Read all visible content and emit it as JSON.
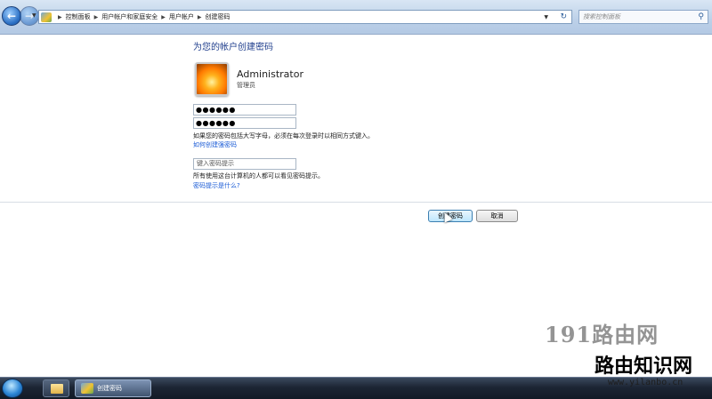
{
  "address_bar": {
    "breadcrumbs": [
      "控制面板",
      "用户帐户和家庭安全",
      "用户帐户",
      "创建密码"
    ],
    "search_placeholder": "搜索控制面板"
  },
  "main": {
    "title": "为您的帐户创建密码",
    "user": {
      "name": "Administrator",
      "role": "管理员"
    },
    "new_password": "●●●●●●",
    "confirm_password": "●●●●●●",
    "case_note": "如果您的密码包括大写字母，必须在每次登录时以相同方式键入。",
    "strong_password_link": "如何创建强密码",
    "hint_placeholder": "键入密码提示",
    "hint_note": "所有使用这台计算机的人都可以看见密码提示。",
    "hint_link": "密码提示是什么?"
  },
  "buttons": {
    "create": "创建密码",
    "cancel": "取消"
  },
  "watermark": {
    "line1": "191路由网",
    "line2": "路由知识网",
    "url": "www.yilanbo.cn"
  },
  "taskbar": {
    "window_label": "创建密码"
  }
}
